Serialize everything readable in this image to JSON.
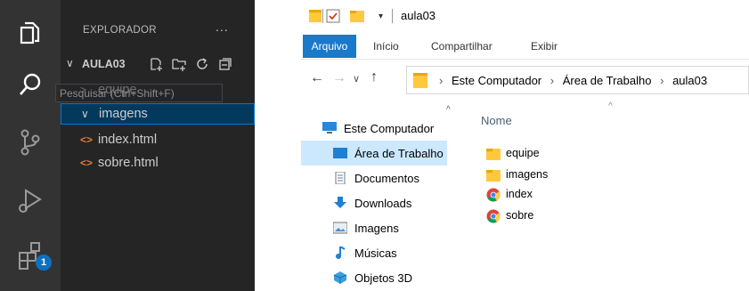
{
  "vscode": {
    "explorer_title": "EXPLORADOR",
    "more_actions": "...",
    "folder": "AULA03",
    "tooltip": "Pesquisar (Ctrl+Shift+F)",
    "extensions_badge": "1",
    "tree": [
      {
        "label": "equipe",
        "type": "folder",
        "expanded": false
      },
      {
        "label": "imagens",
        "type": "folder",
        "expanded": true,
        "selected": true
      },
      {
        "label": "index.html",
        "type": "file"
      },
      {
        "label": "sobre.html",
        "type": "file"
      }
    ],
    "html_icon": "<>",
    "colors": {
      "sidebar": "#252526",
      "activity_bar": "#333333",
      "selection": "#04395e",
      "focus_border": "#0078d4",
      "html_icon": "#e37933"
    }
  },
  "explorer": {
    "window_title": "aula03",
    "ribbon_tabs": [
      "Arquivo",
      "Início",
      "Compartilhar",
      "Exibir"
    ],
    "breadcrumb": [
      "Este Computador",
      "Área de Trabalho",
      "aula03"
    ],
    "nav_items": [
      "Este Computador",
      "Área de Trabalho",
      "Documentos",
      "Downloads",
      "Imagens",
      "Músicas",
      "Objetos 3D"
    ],
    "column_header": "Nome",
    "files": [
      {
        "name": "equipe",
        "icon": "folder-icon"
      },
      {
        "name": "imagens",
        "icon": "folder-icon"
      },
      {
        "name": "index",
        "icon": "chrome-icon"
      },
      {
        "name": "sobre",
        "icon": "chrome-icon"
      }
    ],
    "colors": {
      "arquivo_tab": "#1979ca",
      "nav_selected": "#cce8ff",
      "folder": "#ffc83d"
    }
  }
}
